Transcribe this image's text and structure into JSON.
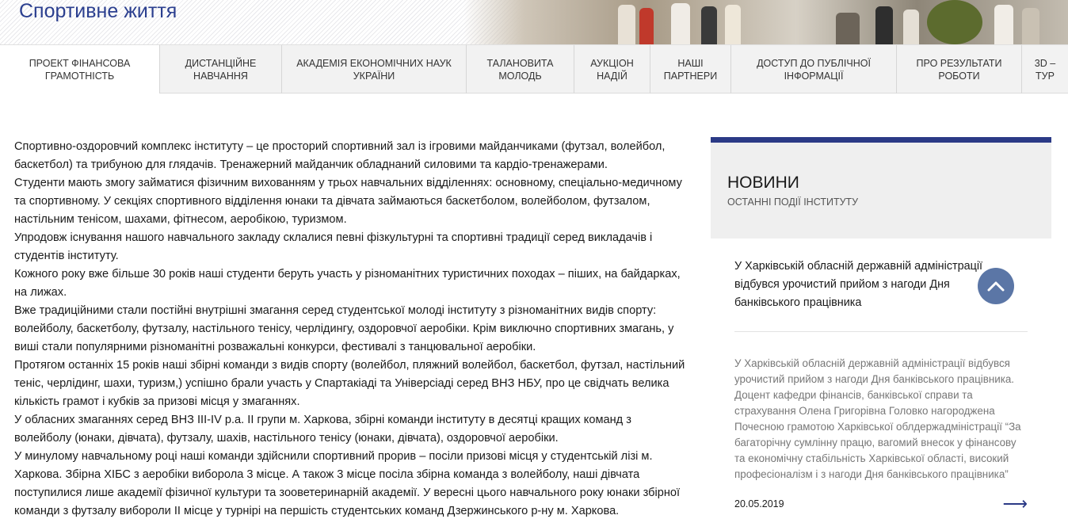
{
  "header": {
    "title": "Спортивне життя"
  },
  "nav": {
    "items": [
      {
        "label": "ПРОЕКТ ФІНАНСОВА ГРАМОТНІСТЬ"
      },
      {
        "label": "ДИСТАНЦІЙНЕ НАВЧАННЯ"
      },
      {
        "label": "АКАДЕМІЯ ЕКОНОМІЧНИХ НАУК УКРАЇНИ"
      },
      {
        "label": "ТАЛАНОВИТА МОЛОДЬ"
      },
      {
        "label": "АУКЦІОН НАДІЙ"
      },
      {
        "label": "НАШІ ПАРТНЕРИ"
      },
      {
        "label": "ДОСТУП ДО ПУБЛІЧНОЇ ІНФОРМАЦІЇ"
      },
      {
        "label": "ПРО РЕЗУЛЬТАТИ РОБОТИ"
      },
      {
        "label": "3D – ТУР"
      }
    ]
  },
  "article": {
    "paragraphs": [
      "Спортивно-оздоровчий комплекс інституту – це просторий спортивний зал із ігровими майданчиками (футзал, волейбол, баскетбол) та трибуною для глядачів. Тренажерний майданчик обладнаний силовими та кардіо-тренажерами.",
      "Студенти мають змогу займатися фізичним вихованням у трьох навчальних відділеннях: основному, спеціально-медичному та спортивному. У секціях спортивного відділення юнаки та дівчата займаються баскетболом, волейболом, футзалом, настільним тенісом, шахами, фітнесом, аеробікою, туризмом.",
      "Упродовж існування нашого навчального закладу склалися певні фізкультурні та спортивні традиції серед викладачів і студентів інституту.",
      "Кожного року вже більше 30 років наші студенти беруть участь у різноманітних туристичних походах – піших, на байдарках, на лижах.",
      "Вже традиційними стали постійні внутрішні змагання серед студентської молоді інституту з різноманітних видів спорту: волейболу, баскетболу, футзалу, настільного тенісу, черлідингу, оздоровчої аеробіки. Крім виключно спортивних змагань, у виші стали популярними різноманітні розважальні конкурси, фестивалі з танцювальної аеробіки.",
      "Протягом останніх 15 років наші збірні команди з видів спорту (волейбол, пляжний волейбол, баскетбол, футзал, настільний теніс, черлідинг, шахи, туризм,) успішно брали участь у Спартакіаді та Універсіаді серед ВНЗ НБУ, про це свідчать велика кількість грамот і кубків за призові місця у змаганнях.",
      "У обласних змаганнях серед ВНЗ ІІІ-IV р.а. ІІ групи м. Харкова, збірні команди інституту в десятці кращих команд з волейболу (юнаки, дівчата), футзалу, шахів, настільного тенісу (юнаки, дівчата), оздоровчої аеробіки.",
      "У минулому навчальному році наші команди здійснили спортивний прорив – посіли призові місця у студентській лізі м. Харкова. Збірна ХІБС з аеробіки виборола 3 місце. А також 3 місце посіла збірна команда з волейболу, наші дівчата поступилися лише академії фізичної культури та зооветеринарній академії. У вересні цього навчального року юнаки збірної команди з футзалу вибороли ІІ місце у турнірі на першість студентських команд Дзержинського р-ну м. Харкова."
    ]
  },
  "sidebar": {
    "title": "НОВИНИ",
    "subtitle": "ОСТАННІ ПОДІЇ ІНСТИТУТУ",
    "news": {
      "headline": "У Харківській обласній державній адміністрації відбувся урочистий прийом з нагоди Дня банківського працівника",
      "excerpt": "У Харківській обласній державній адміністрації відбувся урочистий прийом з нагоди Дня банківського працівника. Доцент кафедри фінансів, банківської справи та страхування Олена Григорівна Головко нагороджена Почесною грамотою Харківської облдержадміністрації “За багаторічну сумлінну працю, вагомий внесок у фінансову та економічну стабільність Харківської області, високий професіоналізм і з нагоди Дня банківського працівника”",
      "date": "20.05.2019",
      "arrow": "⟶"
    }
  },
  "colors": {
    "title_blue": "#2b3f8f",
    "sidebar_accent": "#2b3a86",
    "scroll_button": "#5b76a6"
  },
  "icons": {
    "scroll_top": "chevron-up-icon",
    "next": "arrow-right-icon"
  }
}
